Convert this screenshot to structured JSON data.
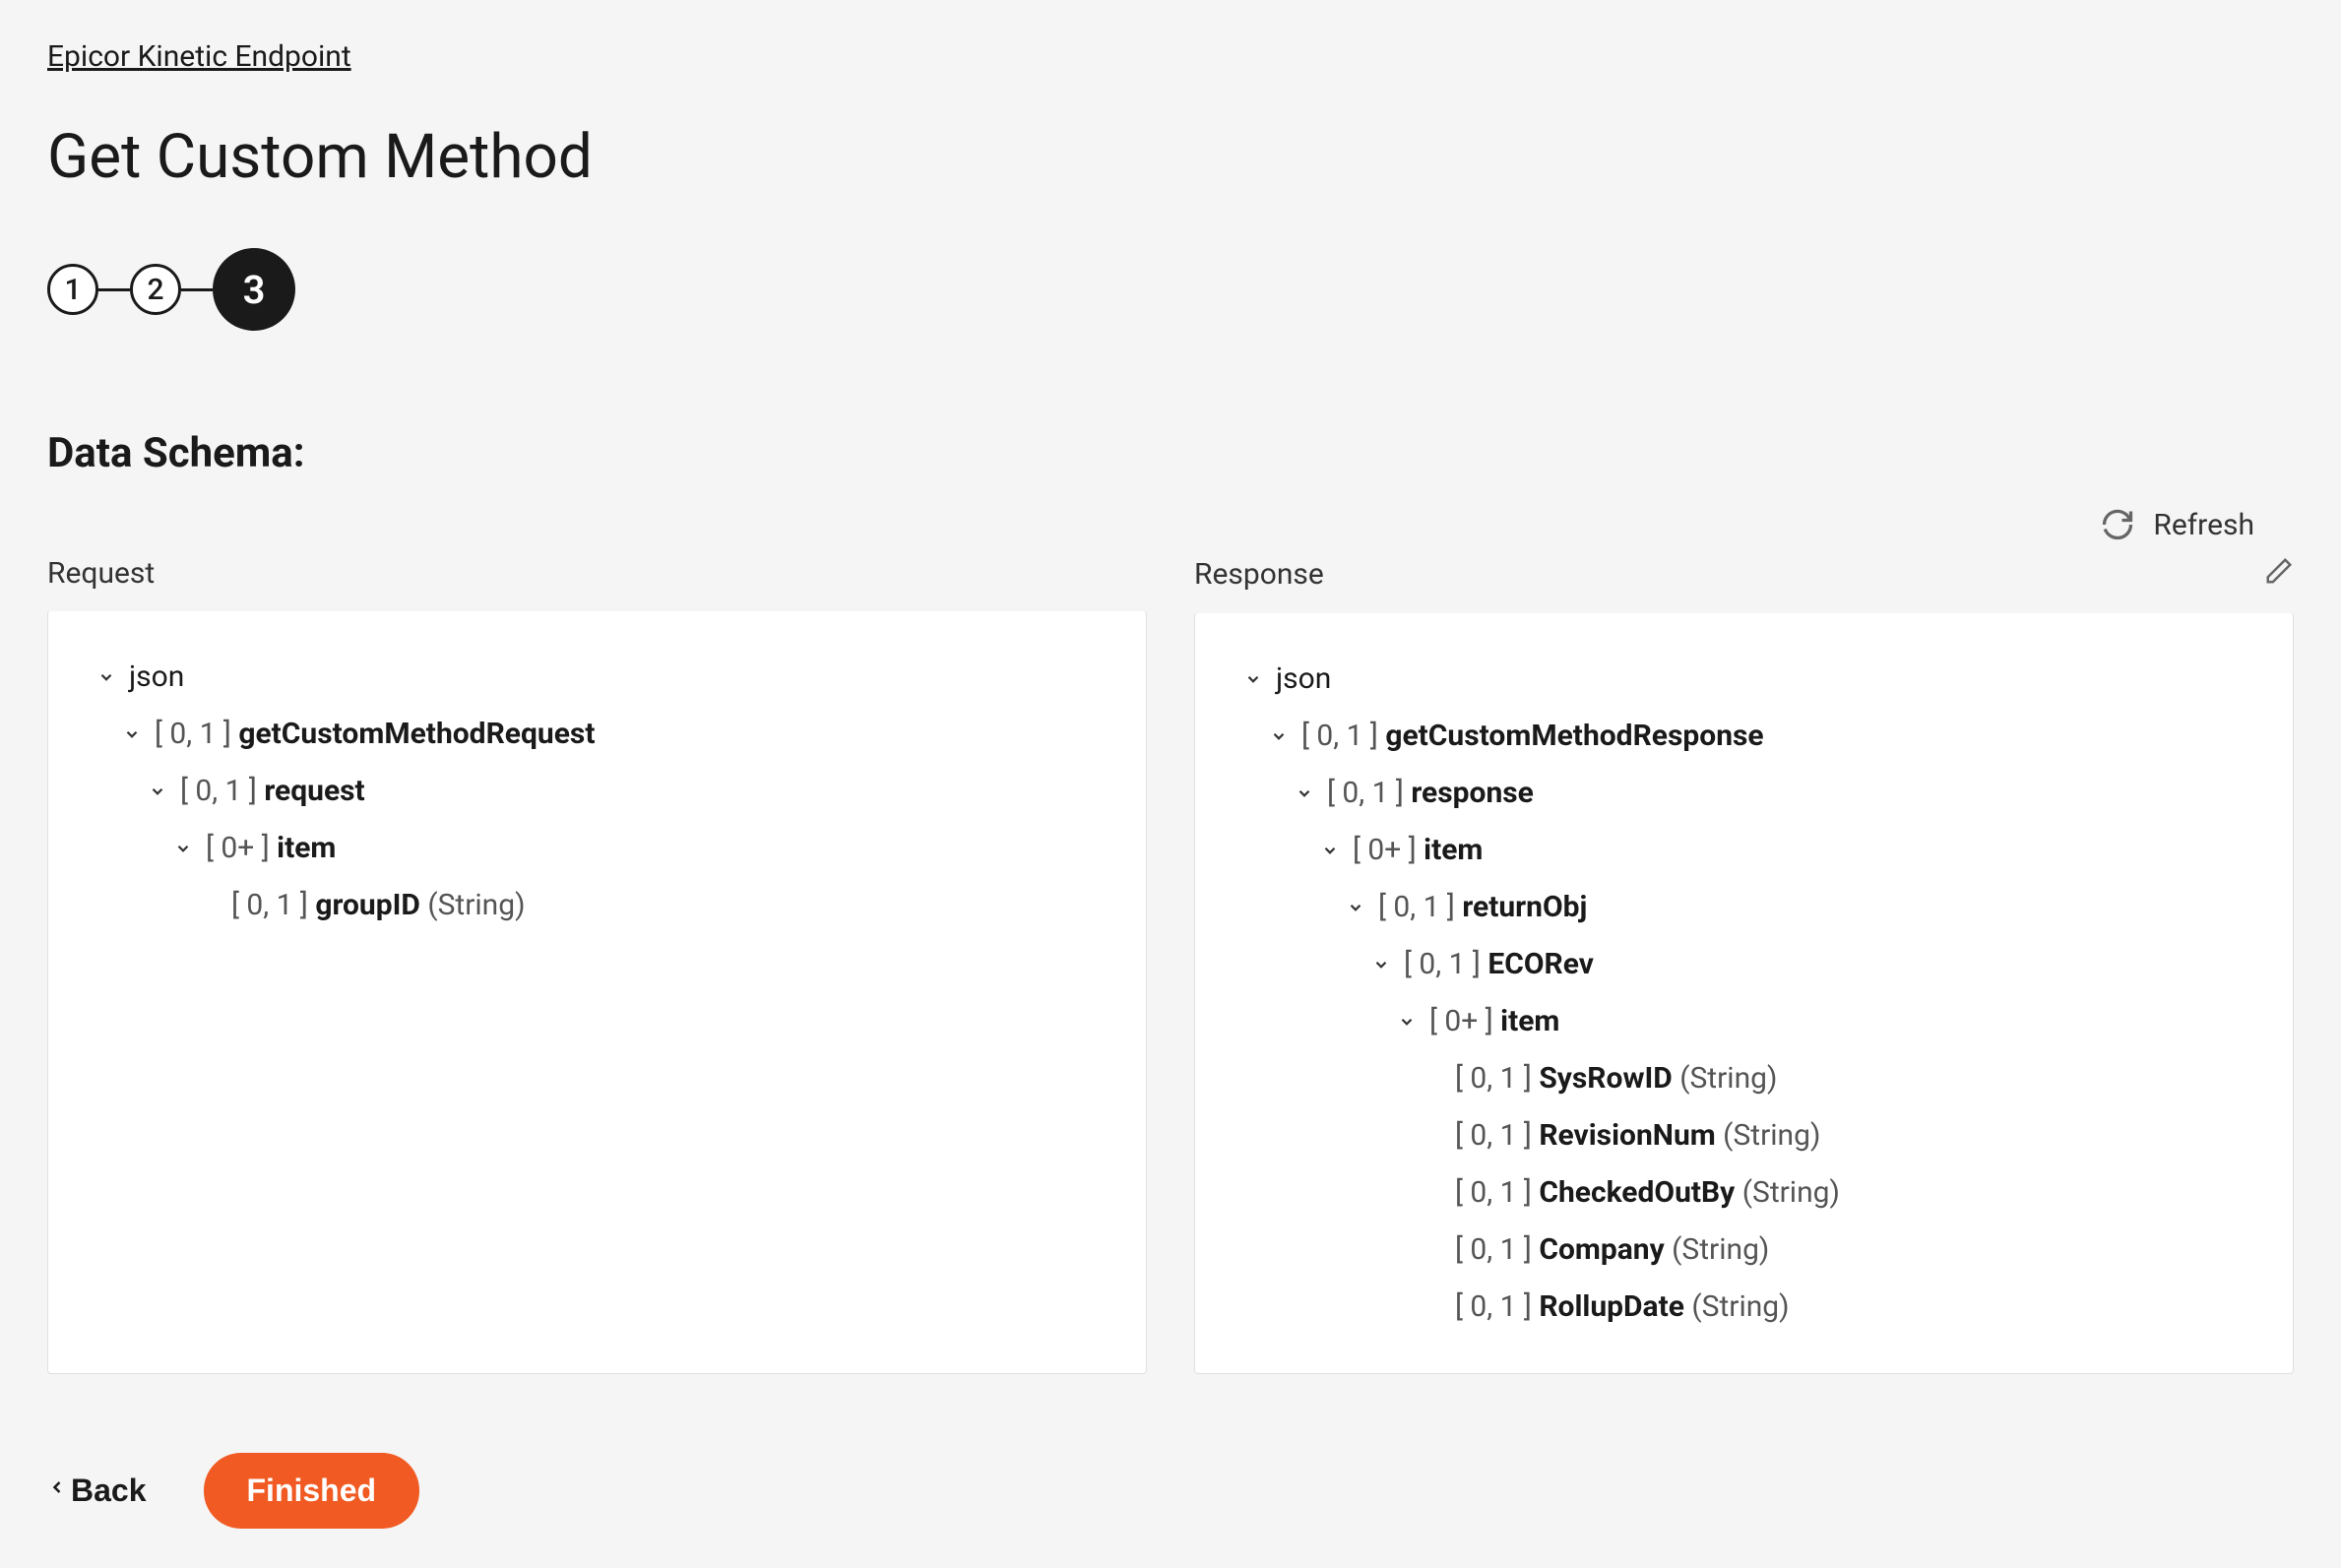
{
  "breadcrumb": "Epicor Kinetic Endpoint",
  "page_title": "Get Custom Method",
  "stepper": {
    "steps": [
      "1",
      "2",
      "3"
    ],
    "active_index": 2
  },
  "section_title": "Data Schema:",
  "toolbar": {
    "refresh_label": "Refresh"
  },
  "schema_panels": {
    "request": {
      "title": "Request",
      "tree": [
        {
          "indent": 0,
          "expandable": true,
          "card": "",
          "name": "json",
          "bold": false,
          "type": ""
        },
        {
          "indent": 1,
          "expandable": true,
          "card": "[ 0, 1 ]",
          "name": "getCustomMethodRequest",
          "bold": true,
          "type": ""
        },
        {
          "indent": 2,
          "expandable": true,
          "card": "[ 0, 1 ]",
          "name": "request",
          "bold": true,
          "type": ""
        },
        {
          "indent": 3,
          "expandable": true,
          "card": "[ 0+ ]",
          "name": "item",
          "bold": true,
          "type": ""
        },
        {
          "indent": 4,
          "expandable": false,
          "card": "[ 0, 1 ]",
          "name": "groupID",
          "bold": true,
          "type": "(String)"
        }
      ]
    },
    "response": {
      "title": "Response",
      "tree": [
        {
          "indent": 0,
          "expandable": true,
          "card": "",
          "name": "json",
          "bold": false,
          "type": ""
        },
        {
          "indent": 1,
          "expandable": true,
          "card": "[ 0, 1 ]",
          "name": "getCustomMethodResponse",
          "bold": true,
          "type": ""
        },
        {
          "indent": 2,
          "expandable": true,
          "card": "[ 0, 1 ]",
          "name": "response",
          "bold": true,
          "type": ""
        },
        {
          "indent": 3,
          "expandable": true,
          "card": "[ 0+ ]",
          "name": "item",
          "bold": true,
          "type": ""
        },
        {
          "indent": 4,
          "expandable": true,
          "card": "[ 0, 1 ]",
          "name": "returnObj",
          "bold": true,
          "type": ""
        },
        {
          "indent": 5,
          "expandable": true,
          "card": "[ 0, 1 ]",
          "name": "ECORev",
          "bold": true,
          "type": ""
        },
        {
          "indent": 6,
          "expandable": true,
          "card": "[ 0+ ]",
          "name": "item",
          "bold": true,
          "type": ""
        },
        {
          "indent": 7,
          "expandable": false,
          "card": "[ 0, 1 ]",
          "name": "SysRowID",
          "bold": true,
          "type": "(String)"
        },
        {
          "indent": 7,
          "expandable": false,
          "card": "[ 0, 1 ]",
          "name": "RevisionNum",
          "bold": true,
          "type": "(String)"
        },
        {
          "indent": 7,
          "expandable": false,
          "card": "[ 0, 1 ]",
          "name": "CheckedOutBy",
          "bold": true,
          "type": "(String)"
        },
        {
          "indent": 7,
          "expandable": false,
          "card": "[ 0, 1 ]",
          "name": "Company",
          "bold": true,
          "type": "(String)"
        },
        {
          "indent": 7,
          "expandable": false,
          "card": "[ 0, 1 ]",
          "name": "RollupDate",
          "bold": true,
          "type": "(String)"
        }
      ]
    }
  },
  "footer": {
    "back_label": "Back",
    "finished_label": "Finished"
  }
}
